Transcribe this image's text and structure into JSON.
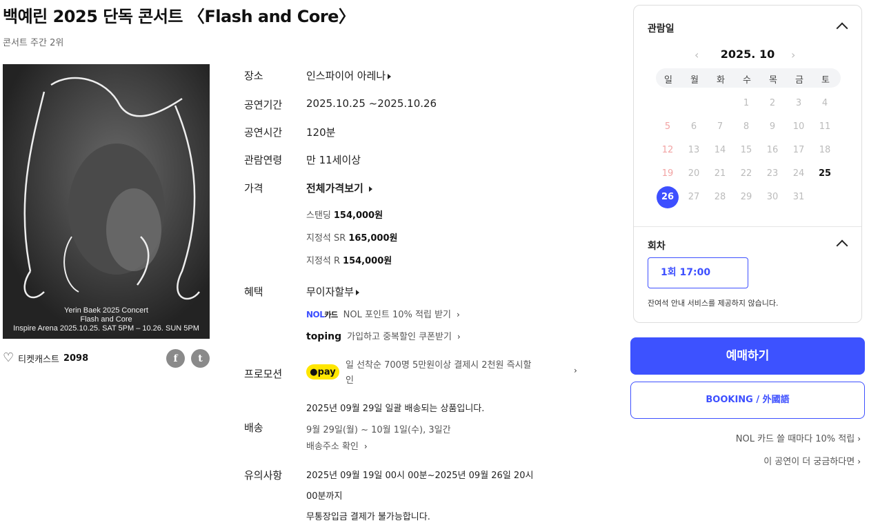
{
  "header": {
    "title": "백예린 2025 단독 콘서트 〈Flash and Core〉",
    "rank": "콘서트 주간 2위"
  },
  "poster": {
    "caption_line1": "Yerin Baek 2025 Concert",
    "caption_line2": "Flash and Core",
    "caption_line3": "Inspire Arena 2025.10.25. SAT 5PM – 10.26. SUN 5PM"
  },
  "social": {
    "cast_label": "티켓캐스트",
    "cast_count": "2098",
    "facebook_icon": "f",
    "twitter_icon": "t"
  },
  "info": {
    "venue_label": "장소",
    "venue_value": "인스파이어 아레나",
    "period_label": "공연기간",
    "period_value": "2025.10.25 ~2025.10.26",
    "runtime_label": "공연시간",
    "runtime_value": "120분",
    "age_label": "관람연령",
    "age_value": "만 11세이상",
    "price_label": "가격",
    "price_all": "전체가격보기",
    "prices": [
      {
        "seat": "스탠딩",
        "price": "154,000원"
      },
      {
        "seat": "지정석 SR",
        "price": "165,000원"
      },
      {
        "seat": "지정석 R",
        "price": "154,000원"
      }
    ],
    "benefit_label": "혜택",
    "benefit_value": "무이자할부",
    "nol_logo": "NOL",
    "nol_logo_suffix": "카드",
    "nol_text": "NOL 포인트 10% 적립 받기",
    "toping_logo": "toping",
    "toping_text": "가입하고 중복할인 쿠폰받기",
    "promo_label": "프로모션",
    "pay_logo": "●pay",
    "promo_line1": "일 선착순 700명 5만원이상 결제시 2천원 즉시할",
    "promo_line2": "인",
    "delivery_label": "배송",
    "delivery_line1": "2025년 09월 29일 일괄 배송되는 상품입니다.",
    "delivery_line2": "9월 29일(월) ~ 10월 1일(수), 3일간",
    "delivery_line3": "배송주소 확인",
    "caution_label": "유의사항",
    "caution_line1": "2025년 09월 19일 00시 00분~2025년 09월 26일 20시",
    "caution_line2": "00분까지",
    "caution_line3": "무통장입금 결제가 불가능합니다."
  },
  "calendar": {
    "section_label": "관람일",
    "month": "2025. 10",
    "weekdays": [
      "일",
      "월",
      "화",
      "수",
      "목",
      "금",
      "토"
    ],
    "selected_day": "26",
    "available_days": [
      "25",
      "26"
    ],
    "session_label": "회차",
    "session": "1회 17:00",
    "notice": "잔여석 안내 서비스를 제공하지 않습니다."
  },
  "actions": {
    "book": "예매하기",
    "book_foreign": "BOOKING / 外國語",
    "nol_card_link": "NOL 카드 쓸 때마다 10% 적립",
    "more_link": "이 공연이 더 궁금하다면"
  },
  "colors": {
    "primary": "#3d52ff",
    "pay_yellow": "#ffe600",
    "sunday": "#f2a3a3"
  }
}
